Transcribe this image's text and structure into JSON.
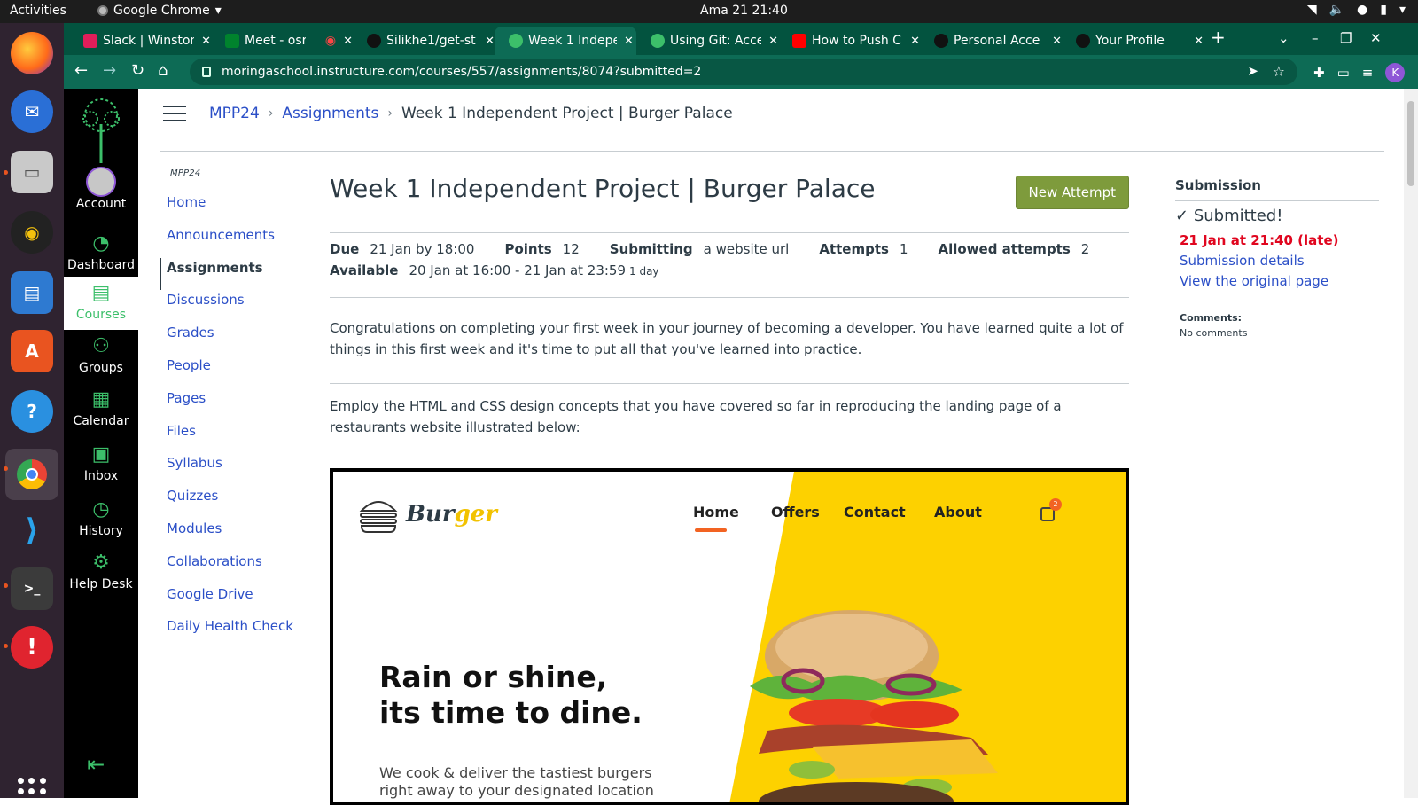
{
  "os": {
    "activities": "Activities",
    "app_name": "Google Chrome",
    "clock": "Ama 21  21:40"
  },
  "browser": {
    "tabs": [
      {
        "title": "Slack | Winston",
        "favicon_color": "#e01e5a"
      },
      {
        "title": "Meet - osr-j",
        "favicon_color": "#00832d"
      },
      {
        "title": "Silikhe1/get-st",
        "favicon_color": "#111111"
      },
      {
        "title": "Week 1 Indepe",
        "favicon_color": "#3cbf6a"
      },
      {
        "title": "Using Git: Acce",
        "favicon_color": "#3cbf6a"
      },
      {
        "title": "How to Push C",
        "favicon_color": "#ff0000"
      },
      {
        "title": "Personal Acce",
        "favicon_color": "#111111"
      },
      {
        "title": "Your Profile",
        "favicon_color": "#111111"
      }
    ],
    "url": "moringaschool.instructure.com/courses/557/assignments/8074?submitted=2",
    "profile_initial": "K"
  },
  "global_nav": [
    {
      "label": "Account",
      "icon": "account-icon"
    },
    {
      "label": "Dashboard",
      "icon": "dashboard-icon"
    },
    {
      "label": "Courses",
      "icon": "courses-icon"
    },
    {
      "label": "Groups",
      "icon": "groups-icon"
    },
    {
      "label": "Calendar",
      "icon": "calendar-icon"
    },
    {
      "label": "Inbox",
      "icon": "inbox-icon"
    },
    {
      "label": "History",
      "icon": "history-icon"
    },
    {
      "label": "Help Desk",
      "icon": "help-desk-icon"
    }
  ],
  "breadcrumb": [
    "MPP24",
    "Assignments",
    "Week 1 Independent Project | Burger Palace"
  ],
  "course_nav": {
    "term": "MPP24",
    "items": [
      "Home",
      "Announcements",
      "Assignments",
      "Discussions",
      "Grades",
      "People",
      "Pages",
      "Files",
      "Syllabus",
      "Quizzes",
      "Modules",
      "Collaborations",
      "Google Drive",
      "Daily Health Check"
    ]
  },
  "assignment": {
    "title": "Week 1 Independent Project | Burger Palace",
    "new_attempt": "New Attempt",
    "due_label": "Due",
    "due": "21 Jan by 18:00",
    "points_label": "Points",
    "points": "12",
    "submitting_label": "Submitting",
    "submitting": "a website url",
    "attempts_label": "Attempts",
    "attempts": "1",
    "allowed_label": "Allowed attempts",
    "allowed": "2",
    "available_label": "Available",
    "available": "20 Jan at 16:00 - 21 Jan at 23:59",
    "available_note": "1 day",
    "para1": "Congratulations on completing your first week in your journey of becoming a developer. You have learned quite a lot of things in this first week and it's time to put all that you've learned into practice.",
    "para2": "Employ the HTML and CSS design concepts that you have covered so far in reproducing the landing page of a restaurants website illustrated below:"
  },
  "mockup": {
    "brand_a": "Bur",
    "brand_b": "ger",
    "nav": [
      "Home",
      "Offers",
      "Contact",
      "About"
    ],
    "cart_count": "2",
    "hero_line1": "Rain or shine,",
    "hero_line2": "its time to dine.",
    "sub_line1": "We cook & deliver the tastiest burgers",
    "sub_line2": "right away to your designated location",
    "accent": "#fdd100"
  },
  "submission": {
    "heading": "Submission",
    "status": "Submitted!",
    "when": "21 Jan at 21:40 (late)",
    "details": "Submission details",
    "original": "View the original page",
    "comments_label": "Comments:",
    "comments": "No comments"
  }
}
